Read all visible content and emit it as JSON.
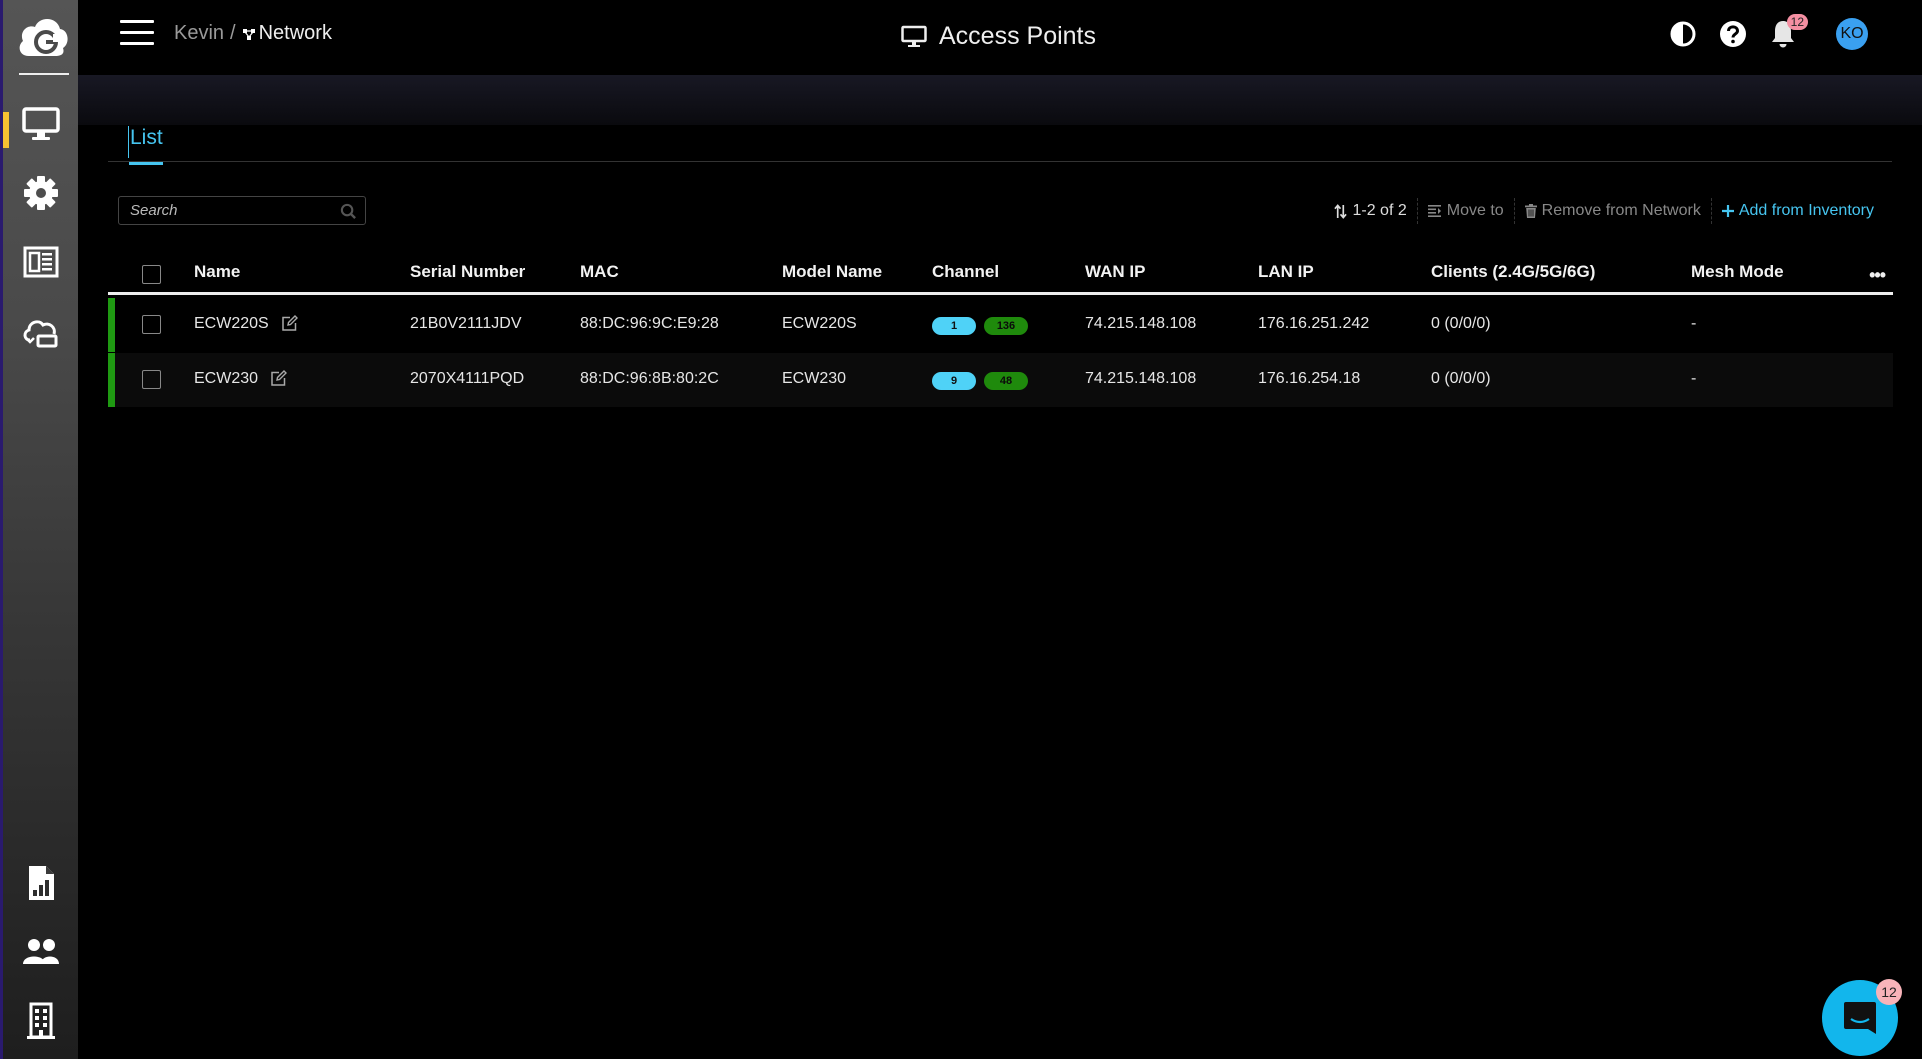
{
  "app": {
    "brand_icon": "gcloud-logo",
    "accent_color": "#46c5f0",
    "active_indicator_color": "#f7c232",
    "online_status_color": "#1f9a12"
  },
  "sidebar": {
    "items": [
      {
        "name": "devices",
        "icon": "monitor-icon",
        "active": true
      },
      {
        "name": "settings",
        "icon": "gear-icon",
        "active": false
      },
      {
        "name": "dashboard",
        "icon": "layout-icon",
        "active": false
      },
      {
        "name": "cloud-sync",
        "icon": "cloud-device-icon",
        "active": false
      },
      {
        "name": "reports",
        "icon": "report-icon",
        "active": false
      },
      {
        "name": "users",
        "icon": "users-icon",
        "active": false
      },
      {
        "name": "organization",
        "icon": "building-icon",
        "active": false
      }
    ]
  },
  "header": {
    "breadcrumb_root": "Kevin",
    "breadcrumb_sep": "/",
    "breadcrumb_current": "Network",
    "title": "Access Points",
    "notification_count": "12",
    "avatar_initials": "KO"
  },
  "tabs": [
    {
      "label": "List",
      "active": true
    }
  ],
  "toolbar": {
    "search_placeholder": "Search",
    "search_value": "",
    "count_label": "1-2 of 2",
    "move_label": "Move to",
    "remove_label": "Remove from Network",
    "add_label": "Add from Inventory"
  },
  "table": {
    "columns": [
      "Name",
      "Serial Number",
      "MAC",
      "Model Name",
      "Channel",
      "WAN IP",
      "LAN IP",
      "Clients (2.4G/5G/6G)",
      "Mesh Mode"
    ],
    "rows": [
      {
        "name": "ECW220S",
        "serial": "21B0V2111JDV",
        "mac": "88:DC:96:9C:E9:28",
        "model": "ECW220S",
        "channel_24": "1",
        "channel_5": "136",
        "wan_ip": "74.215.148.108",
        "lan_ip": "176.16.251.242",
        "clients": "0 (0/0/0)",
        "mesh_mode": "-",
        "status": "online"
      },
      {
        "name": "ECW230",
        "serial": "2070X4111PQD",
        "mac": "88:DC:96:8B:80:2C",
        "model": "ECW230",
        "channel_24": "9",
        "channel_5": "48",
        "wan_ip": "74.215.148.108",
        "lan_ip": "176.16.254.18",
        "clients": "0 (0/0/0)",
        "mesh_mode": "-",
        "status": "online"
      }
    ]
  },
  "chat": {
    "badge_count": "12"
  }
}
